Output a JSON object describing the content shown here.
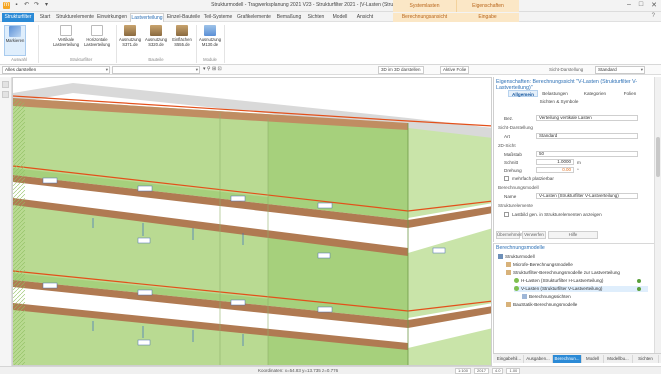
{
  "window": {
    "title": "Strukturmodell - Tragwerksplanung 2021 V23 - Strukturfilter 2021 - |V-Lasten (Strukturfilter V-Lastverteilung)",
    "contextual_group_1": "Systemlasten",
    "contextual_group_2": "Eigenschaften",
    "window_controls": [
      "–",
      "□",
      "✕"
    ]
  },
  "ribbon_tabs": [
    {
      "label": "Strukturfilter",
      "type": "file"
    },
    {
      "label": "Start",
      "type": "normal"
    },
    {
      "label": "Strukturelemente",
      "type": "normal"
    },
    {
      "label": "Einwirkungen",
      "type": "normal"
    },
    {
      "label": "Lastverteilung",
      "type": "active"
    },
    {
      "label": "Einzel-Bauteile",
      "type": "normal"
    },
    {
      "label": "Teil-Systeme",
      "type": "normal"
    },
    {
      "label": "Grafikelemente",
      "type": "normal"
    },
    {
      "label": "Bemaßung",
      "type": "normal"
    },
    {
      "label": "Sichten",
      "type": "normal"
    },
    {
      "label": "Modell",
      "type": "normal"
    },
    {
      "label": "Ansicht",
      "type": "normal"
    },
    {
      "label": "Berechnungsansicht",
      "type": "ctx"
    },
    {
      "label": "Eingabe",
      "type": "ctx"
    }
  ],
  "ribbon": {
    "buttons": [
      {
        "label": "Markieren"
      },
      {
        "label": "Vertikale Lastverteilung"
      },
      {
        "label": "Horizontale Lastverteilung"
      },
      {
        "label": "Ausnutzung S371.de"
      },
      {
        "label": "Ausnutzung S320.de"
      },
      {
        "label": "Einflächen S555.de"
      },
      {
        "label": "Ausnutzung M130.de"
      }
    ],
    "groups": [
      "Auswahl",
      "Strukturfilter",
      "Bauteile",
      "Module"
    ]
  },
  "toolbar": {
    "layer_combo": "Alles darstellen",
    "view_combo": "",
    "view3d_label": "3D im 3D darstellen",
    "active_floor_label": "Aktive Folie",
    "view_label": "Sicht-Darstellung",
    "view_value": "Standard"
  },
  "properties": {
    "header": "Eigenschaften: Berechnungssicht \"V-Lasten (Strukturfilter V-Lastverteilung)\"",
    "tabs": [
      "Allgemein",
      "Belastungen",
      "Kategorien",
      "Folien"
    ],
    "subtab": "Sichten & Symbole",
    "bez_label": "Bez.",
    "bez_value": "Verteilung vertikale Lasten",
    "sec_sicht": "Sicht-Darstellung",
    "art_label": "Art",
    "art_value": "Standard",
    "sec_2d": "2D-Sicht",
    "massstab_label": "Maßstab",
    "massstab_value": "50",
    "schnitt_label": "Schnitt",
    "schnitt_value": "1.0000",
    "schnitt_unit": "m",
    "drehung_label": "Drehung",
    "drehung_value": "0.00",
    "drehung_unit": "°",
    "mehrfach_label": "mehrfach platzierbar",
    "sec_berechnung": "Berechnungsmodell",
    "name_label": "Name",
    "name_value": "V-Lasten (Strukturfilter V-Lastverteilung)",
    "sec_struktur": "Strukturelemente",
    "lastbild_label": "Lastbild gen. in Strukturelementen anzeigen",
    "btn1": "Übernehmen",
    "btn2": "Verwerfen",
    "btn3": "Hilfe"
  },
  "tree": {
    "header": "Berechnungsmodelle",
    "items": [
      {
        "label": "Strukturmodell",
        "indent": 0,
        "dot": false
      },
      {
        "label": "Microfe-Berechnungsmodelle",
        "indent": 1,
        "dot": false
      },
      {
        "label": "Strukturfilter-Berechnungsmodelle zur Lastverteilung",
        "indent": 1,
        "dot": false
      },
      {
        "label": "H-Lasten (Strukturfilter H-Lastverteilung)",
        "indent": 2,
        "dot": true
      },
      {
        "label": "V-Lasten (Strukturfilter V-Lastverteilung)",
        "indent": 2,
        "dot": true,
        "selected": true
      },
      {
        "label": "Berechnungssichten",
        "indent": 3,
        "dot": false
      },
      {
        "label": "BauStatik-Berechnungsmodelle",
        "indent": 1,
        "dot": false
      }
    ]
  },
  "bottom_tabs": [
    "Eingabehil...",
    "Ausgaben...",
    "Berechnun...",
    "Modell",
    "Modellbu...",
    "Sichten"
  ],
  "statusbar": {
    "coords": "Koordinaten: x=54.83  y=13.735  z=0.776",
    "fields": [
      "1:100",
      "2017",
      "4.0",
      "1.00"
    ]
  },
  "colors": {
    "accent": "#2b8ad6",
    "slab_green": "#a6d07c",
    "beam_brown": "#b07a52",
    "load_orange": "#e3501a",
    "context_orange": "#fbe7c6"
  }
}
